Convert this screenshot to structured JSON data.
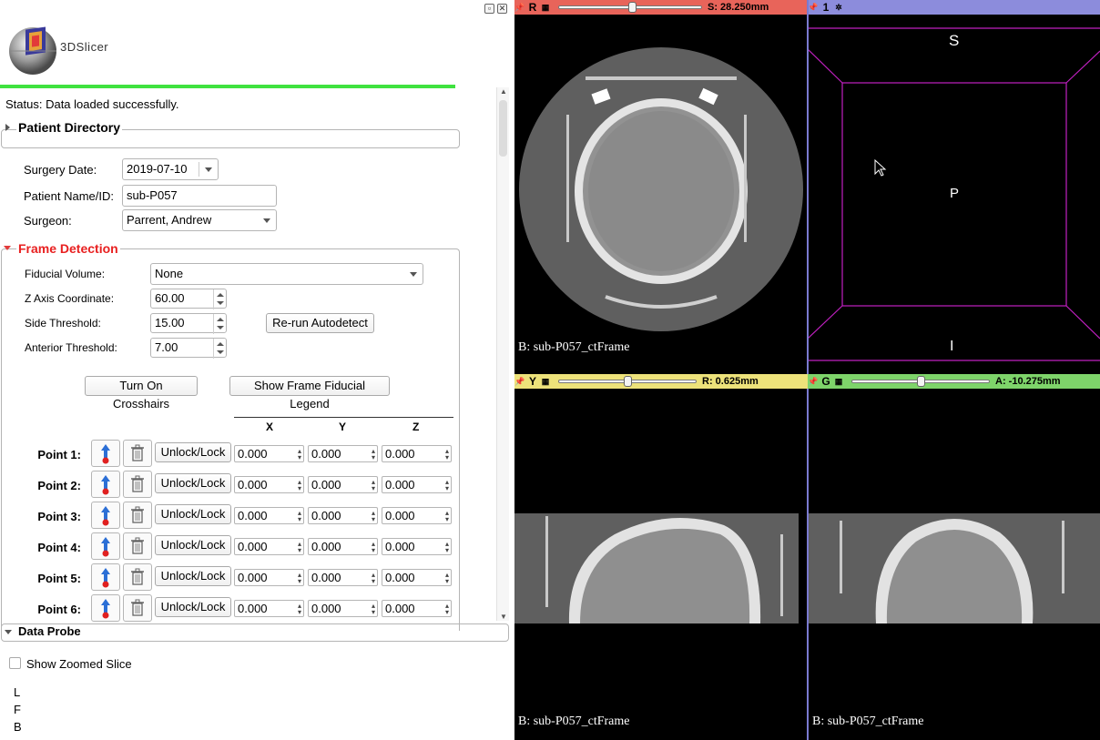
{
  "app": {
    "logo_text": "3DSlicer"
  },
  "status": "Status: Data loaded successfully.",
  "patient_directory": {
    "title": "Patient Directory"
  },
  "form": {
    "surgery_date_label": "Surgery Date:",
    "surgery_date": "2019-07-10",
    "patient_label": "Patient Name/ID:",
    "patient_value": "sub-P057",
    "surgeon_label": "Surgeon:",
    "surgeon_value": "Parrent, Andrew"
  },
  "frame_detection": {
    "title": "Frame Detection",
    "fiducial_volume_label": "Fiducial Volume:",
    "fiducial_volume": "None",
    "z_axis_label": "Z Axis Coordinate:",
    "z_axis": "60.00",
    "side_threshold_label": "Side Threshold:",
    "side_threshold": "15.00",
    "anterior_threshold_label": "Anterior Threshold:",
    "anterior_threshold": "7.00",
    "rerun_button": "Re-run Autodetect",
    "crosshairs_button": "Turn On Crosshairs",
    "legend_button": "Show Frame Fiducial Legend",
    "columns": [
      "X",
      "Y",
      "Z"
    ],
    "lock_label": "Unlock/Lock",
    "points": [
      {
        "label": "Point 1:",
        "x": "0.000",
        "y": "0.000",
        "z": "0.000"
      },
      {
        "label": "Point 2:",
        "x": "0.000",
        "y": "0.000",
        "z": "0.000"
      },
      {
        "label": "Point 3:",
        "x": "0.000",
        "y": "0.000",
        "z": "0.000"
      },
      {
        "label": "Point 4:",
        "x": "0.000",
        "y": "0.000",
        "z": "0.000"
      },
      {
        "label": "Point 5:",
        "x": "0.000",
        "y": "0.000",
        "z": "0.000"
      },
      {
        "label": "Point 6:",
        "x": "0.000",
        "y": "0.000",
        "z": "0.000"
      }
    ]
  },
  "data_probe": {
    "title": "Data Probe",
    "show_zoomed": "Show Zoomed Slice",
    "lines": [
      "L",
      "F",
      "B"
    ]
  },
  "views": {
    "red": {
      "letter": "R",
      "value": "S: 28.250mm",
      "label": "B: sub-P057_ctFrame",
      "color": "#e8645a",
      "slider_pos": 0.52
    },
    "threeD": {
      "letter": "1",
      "color": "#8c8cdc",
      "orient_top": "S",
      "orient_center": "P",
      "orient_bottom": "I"
    },
    "yellow": {
      "letter": "Y",
      "value": "R: 0.625mm",
      "label": "B: sub-P057_ctFrame",
      "color": "#ede27a",
      "slider_pos": 0.5
    },
    "green": {
      "letter": "G",
      "value": "A: -10.275mm",
      "label": "B: sub-P057_ctFrame",
      "color": "#7ed46a",
      "slider_pos": 0.5
    }
  }
}
